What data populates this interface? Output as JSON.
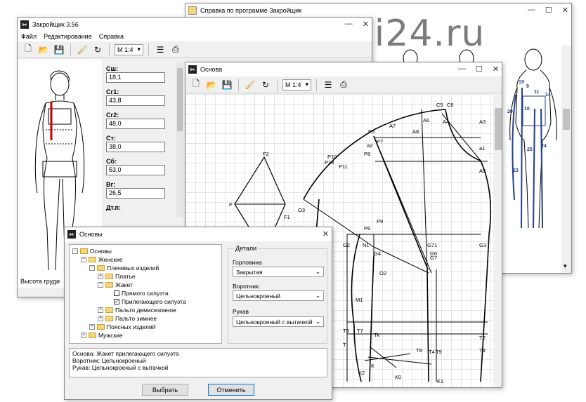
{
  "help_window": {
    "title": "Справка по программе Закройщик",
    "figure_numbers": [
      "19",
      "9",
      "11",
      "14",
      "20",
      "10",
      "25",
      "24",
      "23"
    ]
  },
  "main_window": {
    "title": "Закройщик 3.56",
    "menu": [
      "Файл",
      "Редактирование",
      "Справка"
    ],
    "scale": "М 1:4",
    "status": "Высота груди",
    "fields": [
      {
        "label": "Сш:",
        "value": "18,1"
      },
      {
        "label": "Сг1:",
        "value": "43,8"
      },
      {
        "label": "Сг2:",
        "value": "48,0"
      },
      {
        "label": "Ст:",
        "value": "38,0"
      },
      {
        "label": "Сб:",
        "value": "53,0"
      },
      {
        "label": "Вг:",
        "value": "26,5"
      },
      {
        "label": "Дт.п:",
        "value": ""
      }
    ]
  },
  "osnova_window": {
    "title": "Основа",
    "scale": "М 1:4",
    "points": [
      "C5",
      "C6",
      "A7",
      "A6",
      "A4",
      "A3",
      "P5",
      "a2",
      "P7",
      "A8",
      "a1",
      "P8",
      "P10",
      "P13",
      "P11",
      "A5",
      "F2",
      "F",
      "F1",
      "O3",
      "P9",
      "P6",
      "G2",
      "N1",
      "G71",
      "G3",
      "G4",
      "G6",
      "G7",
      "O2",
      "M1",
      "T5",
      "T7",
      "Tk",
      "T2",
      "T",
      "T8",
      "T4",
      "T9",
      "T3",
      "K",
      "K2",
      "K0",
      "K1"
    ]
  },
  "dialog": {
    "title": "Основы",
    "tree": [
      {
        "label": "Основы",
        "level": 0,
        "type": "folder",
        "exp": "−"
      },
      {
        "label": "Женские",
        "level": 1,
        "type": "folder",
        "exp": "−"
      },
      {
        "label": "Плечевых изделий",
        "level": 2,
        "type": "folder",
        "exp": "−"
      },
      {
        "label": "Платье",
        "level": 3,
        "type": "folder",
        "exp": "+"
      },
      {
        "label": "Жакет",
        "level": 3,
        "type": "folder",
        "exp": "−"
      },
      {
        "label": "Прямого силуэта",
        "level": 4,
        "type": "check",
        "checked": false
      },
      {
        "label": "Прилегающего силуэта",
        "level": 4,
        "type": "check",
        "checked": true
      },
      {
        "label": "Пальто демисезонное",
        "level": 3,
        "type": "folder",
        "exp": "+"
      },
      {
        "label": "Пальто зимнее",
        "level": 3,
        "type": "folder",
        "exp": "+"
      },
      {
        "label": "Поясных изделий",
        "level": 2,
        "type": "folder",
        "exp": "+"
      },
      {
        "label": "Мужские",
        "level": 1,
        "type": "folder",
        "exp": "+"
      }
    ],
    "details_title": "Детали",
    "neckline_label": "Горловина",
    "neckline_value": "Закрытая",
    "collar_label": "Воротник:",
    "collar_value": "Цельнокроеный",
    "sleeve_label": "Рукав",
    "sleeve_value": "Цельнокроеный с вытачкой",
    "summary": [
      "Основа: Жакет прилегающего силуэта",
      "Воротник: Цельнокроеный",
      "Рукав: Цельнокроеный с вытачкой"
    ],
    "select_button": "Выбрать",
    "cancel_button": "Отменить"
  },
  "watermark": "vsekursi24.ru"
}
